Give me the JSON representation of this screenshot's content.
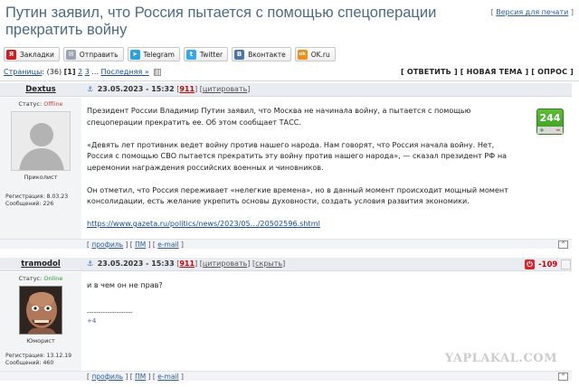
{
  "topic": {
    "title": "Путин заявил, что Россия пытается с помощью спецоперации прекратить войну",
    "print_bracket_open": "[",
    "print_link": "Версия для печати",
    "print_bracket_close": "]"
  },
  "share": [
    {
      "icon": "yandex-icon",
      "label": "Закладки",
      "icon_text": "Я",
      "color": "#d71a1a"
    },
    {
      "icon": "mail-icon",
      "label": "Отправить",
      "icon_text": "✉",
      "color": "#9aa4b0"
    },
    {
      "icon": "telegram-icon",
      "label": "Telegram",
      "icon_text": "➤",
      "color": "#2aa3df"
    },
    {
      "icon": "twitter-icon",
      "label": "Twitter",
      "icon_text": "t",
      "color": "#35a9e3"
    },
    {
      "icon": "vk-icon",
      "label": "Вконтакте",
      "icon_text": "B",
      "color": "#4a76a8"
    },
    {
      "icon": "ok-icon",
      "label": "OK.ru",
      "icon_text": "ok",
      "color": "#f28d18"
    }
  ],
  "pager": {
    "pages_label": "Страницы",
    "count": "(36)",
    "current": "[1]",
    "page2": "2",
    "page3": "3",
    "ellipsis": "...",
    "last": "Последняя »"
  },
  "actions": {
    "reply": "ОТВЕТИТЬ",
    "new_topic": "НОВАЯ ТЕМА",
    "poll": "ОПРОС"
  },
  "posts": [
    {
      "author": "Dextus",
      "date": "23.05.2023 - 15:32",
      "number": "911",
      "quote_link": "цитировать",
      "status_label": "Статус:",
      "status": "Offline",
      "rank": "Приколист",
      "registered": "Регистрация: 8.03.23",
      "messages": "Сообщений: 226",
      "paragraphs": [
        "Президент России Владимир Путин заявил, что Москва не начинала войну, а пытается с помощью спецоперации прекратить ее. Об этом сообщает ТАСС.",
        "«Девять лет противник ведет войну против нашего народа. Нам говорят, что Россия начала войну. Нет, Россия с помощью СВО пытается прекратить эту войну против нашего народа», — сказал президент РФ на церемонии награждения российских военных и чиновников.",
        "Он отметил, что Россия переживает «нелегкие времена», но в данный момент происходит мощный момент консолидации, есть желание укрепить основы духовности, создать условия развития экономики."
      ],
      "url": "https://www.gazeta.ru/politics/news/2023/05…/20502596.shtml",
      "rating": "244",
      "rating_plus": "+",
      "rating_minus": "−",
      "foot": {
        "profile": "профиль",
        "pm": "ПМ",
        "email": "e-mail"
      }
    },
    {
      "author": "tramodol",
      "date": "23.05.2023 - 15:33",
      "number": "911",
      "quote_link": "цитировать",
      "hide_link": "скрыть",
      "status_label": "Статус:",
      "status": "Online",
      "rank": "Юморист",
      "registered": "Регистрация: 13.12.19",
      "messages": "Сообщений: 460",
      "text": "и в чем он не прав?",
      "sig_line": "--------------------",
      "sig": "+4",
      "rating": "-109",
      "foot": {
        "profile": "профиль",
        "pm": "ПМ",
        "email": "e-mail"
      }
    }
  ],
  "watermark": "YAPLAKAL.COM",
  "up_glyph": "[^]"
}
